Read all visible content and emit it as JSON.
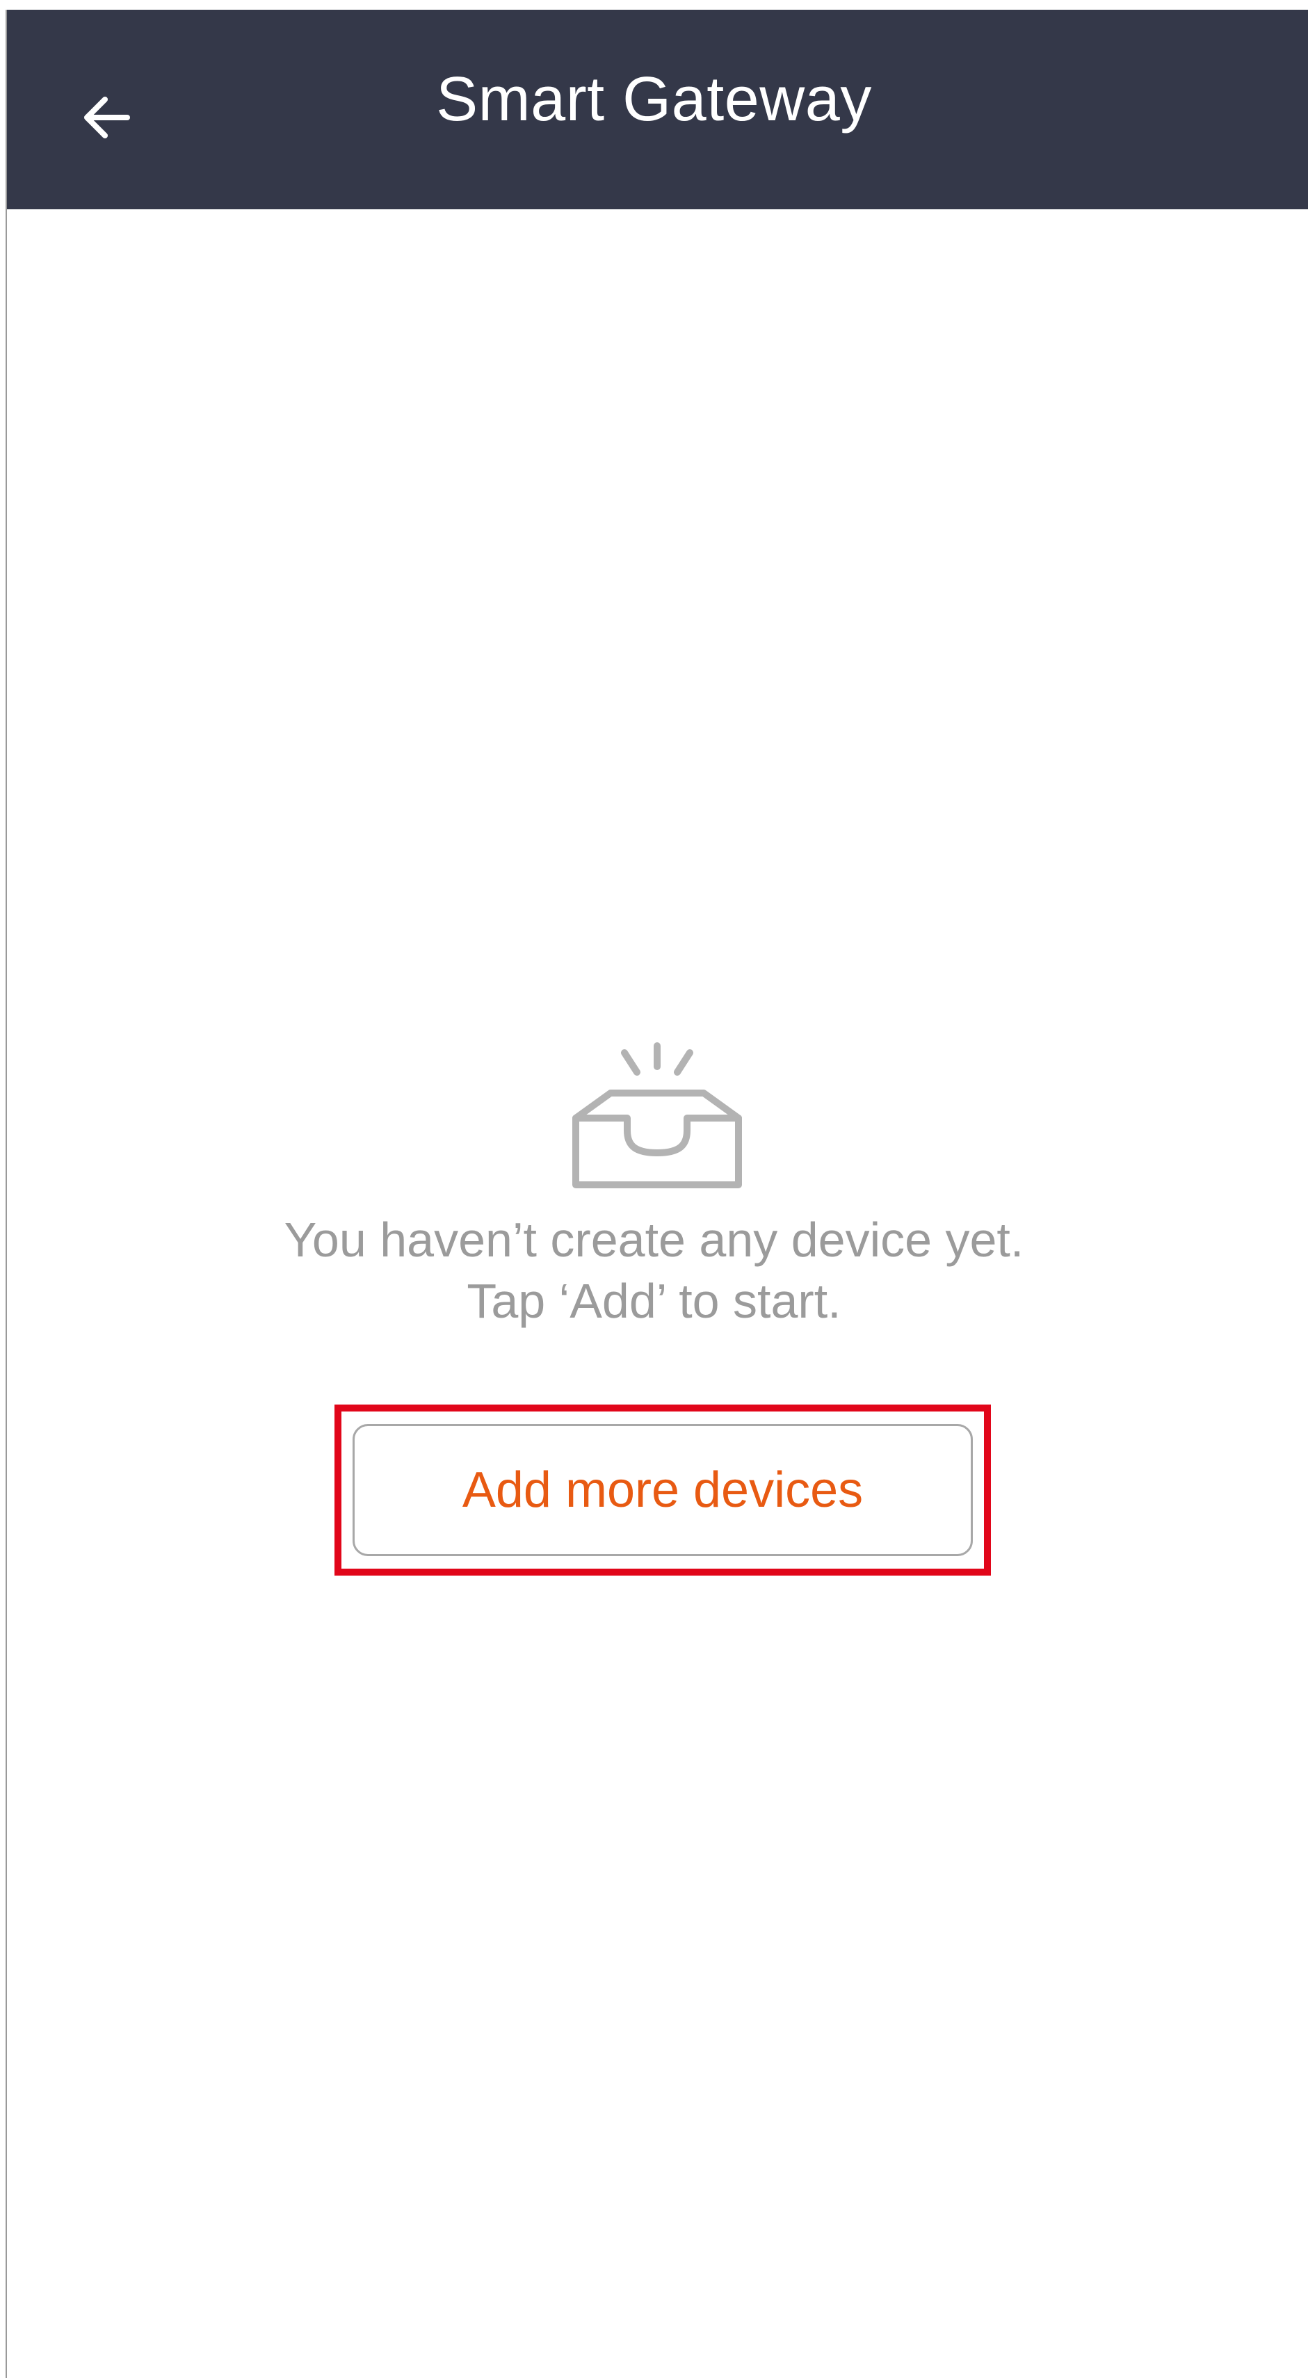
{
  "header": {
    "title": "Smart Gateway",
    "back_icon": "arrow-left-icon",
    "background_color": "#343849"
  },
  "empty_state": {
    "icon": "empty-inbox-icon",
    "line1": "You haven’t create any device yet.",
    "line2": "Tap ‘Add’ to start."
  },
  "actions": {
    "add_more_devices_label": "Add more devices",
    "accent_color": "#e85a12",
    "highlight_color": "#e1061a"
  }
}
